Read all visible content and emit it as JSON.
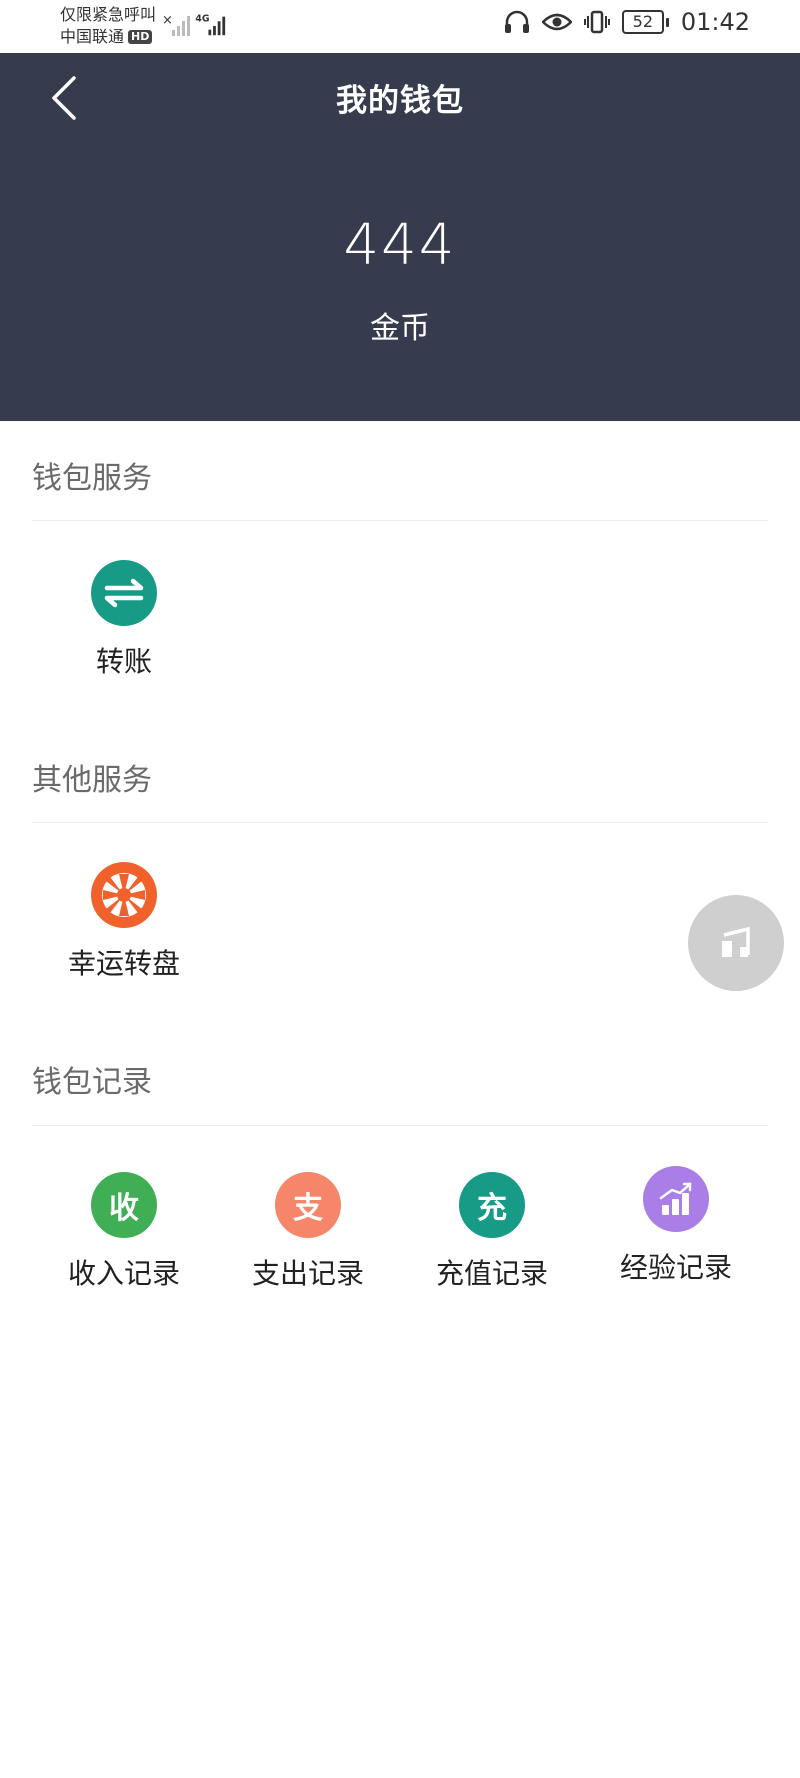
{
  "status_bar": {
    "carrier_line1": "仅限紧急呼叫",
    "carrier_line2": "中国联通",
    "hd_badge": "HD",
    "net_label": "4G",
    "battery": "52",
    "time": "01:42",
    "icons": [
      "no-signal-icon",
      "signal-icon",
      "headphones-icon",
      "eye-icon",
      "vibrate-icon",
      "battery-icon"
    ]
  },
  "header": {
    "title": "我的钱包",
    "balance": "444",
    "unit": "金币",
    "bg_color": "#363b4d"
  },
  "wallet_services": {
    "title": "钱包服务",
    "items": [
      {
        "label": "转账",
        "icon": "transfer-icon",
        "color": "#179a86"
      }
    ]
  },
  "other_services": {
    "title": "其他服务",
    "items": [
      {
        "label": "幸运转盘",
        "icon": "wheel-icon",
        "color": "#f0612c"
      }
    ]
  },
  "wallet_records": {
    "title": "钱包记录",
    "items": [
      {
        "label": "收入记录",
        "glyph": "收",
        "color": "#3fae55"
      },
      {
        "label": "支出记录",
        "glyph": "支",
        "color": "#f5866a"
      },
      {
        "label": "充值记录",
        "glyph": "充",
        "color": "#179a86"
      },
      {
        "label": "经验记录",
        "icon": "bar-chart-icon",
        "color": "#a97ee6"
      }
    ]
  },
  "floating_button": {
    "icon": "music-note-icon"
  }
}
